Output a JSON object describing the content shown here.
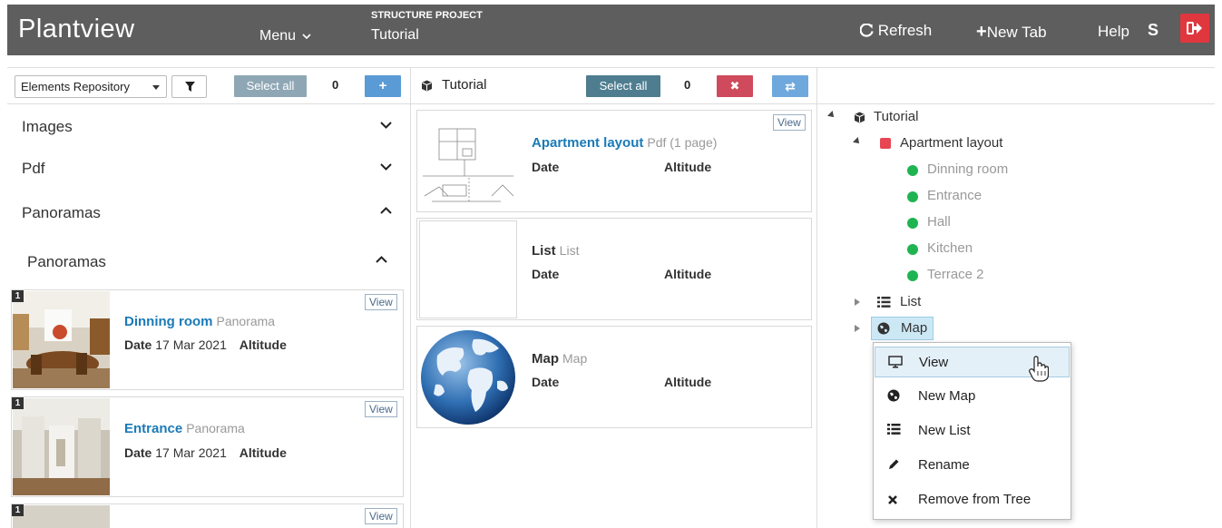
{
  "header": {
    "brand": "Plantview",
    "menu_label": "Menu",
    "project_caption": "STRUCTURE PROJECT",
    "project_name": "Tutorial",
    "refresh_label": "Refresh",
    "new_tab_label": "New Tab",
    "help_label": "Help",
    "user_initial": "S"
  },
  "left_panel": {
    "dropdown_value": "Elements Repository",
    "select_all_label": "Select all",
    "count": "0",
    "sections": [
      {
        "label": "Images",
        "expanded": false
      },
      {
        "label": "Pdf",
        "expanded": false
      },
      {
        "label": "Panoramas",
        "expanded": true
      },
      {
        "label": "Panoramas",
        "expanded": true
      }
    ],
    "items": [
      {
        "badge": "1",
        "title": "Dinning room",
        "type": "Panorama",
        "date_label": "Date",
        "date": "17 Mar 2021",
        "alt_label": "Altitude",
        "view_label": "View"
      },
      {
        "badge": "1",
        "title": "Entrance",
        "type": "Panorama",
        "date_label": "Date",
        "date": "17 Mar 2021",
        "alt_label": "Altitude",
        "view_label": "View"
      },
      {
        "badge": "1",
        "view_label": "View"
      }
    ]
  },
  "middle_panel": {
    "title": "Tutorial",
    "select_all_label": "Select all",
    "count": "0",
    "items": [
      {
        "title": "Apartment layout",
        "type": "Pdf (1 page)",
        "date_label": "Date",
        "alt_label": "Altitude",
        "view_label": "View"
      },
      {
        "title": "List",
        "type": "List",
        "date_label": "Date",
        "alt_label": "Altitude"
      },
      {
        "title": "Map",
        "type": "Map",
        "date_label": "Date",
        "alt_label": "Altitude"
      }
    ]
  },
  "tree": {
    "root": "Tutorial",
    "layout": "Apartment layout",
    "rooms": [
      "Dinning room",
      "Entrance",
      "Hall",
      "Kitchen",
      "Terrace 2"
    ],
    "list": "List",
    "map": "Map"
  },
  "context_menu": {
    "items": [
      {
        "label": "View",
        "icon": "monitor-icon"
      },
      {
        "label": "New Map",
        "icon": "globe-icon"
      },
      {
        "label": "New List",
        "icon": "list-icon"
      },
      {
        "label": "Rename",
        "icon": "pencil-icon"
      },
      {
        "label": "Remove from Tree",
        "icon": "close-icon"
      }
    ]
  },
  "colors": {
    "header_bg": "#5e5e5e",
    "select_all_left": "#8fa7b5",
    "select_all_mid": "#4e7d8f",
    "add_btn": "#5a9bd5",
    "remove_btn": "#cf4a5c",
    "swap_btn": "#6fa8dc",
    "link_blue": "#1a7ab8",
    "status_green": "#1fb451",
    "layout_red": "#e74652",
    "logout_red": "#e0373f"
  }
}
